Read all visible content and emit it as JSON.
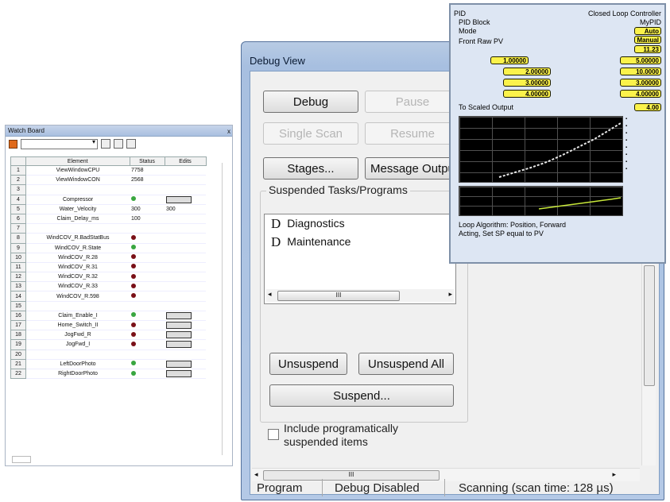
{
  "watch": {
    "title": "Watch Board",
    "close_glyph": "x",
    "headers": {
      "element": "Element",
      "status": "Status",
      "edit": "Edits"
    },
    "rows": [
      {
        "n": "1",
        "element": "ViewWindowCPU",
        "status": "7758",
        "edit": "",
        "kind": "text"
      },
      {
        "n": "2",
        "element": "ViewWindowCON",
        "status": "2568",
        "edit": "",
        "kind": "text"
      },
      {
        "n": "3",
        "element": "",
        "status": "",
        "edit": "",
        "kind": "blank"
      },
      {
        "n": "4",
        "element": "Compressor",
        "status": "",
        "edit": "",
        "kind": "green-mini"
      },
      {
        "n": "5",
        "element": "Water_Velocity",
        "status": "300",
        "edit": "300",
        "kind": "text"
      },
      {
        "n": "6",
        "element": "Claim_Delay_ms",
        "status": "100",
        "edit": "",
        "kind": "text"
      },
      {
        "n": "7",
        "element": "",
        "status": "",
        "edit": "",
        "kind": "blank"
      },
      {
        "n": "8",
        "element": "WindCOV_R.BadStatBus",
        "status": "",
        "edit": "",
        "kind": "red"
      },
      {
        "n": "9",
        "element": "WindCOV_R.State",
        "status": "",
        "edit": "",
        "kind": "green"
      },
      {
        "n": "10",
        "element": "WindCOV_R.28",
        "status": "",
        "edit": "",
        "kind": "red"
      },
      {
        "n": "11",
        "element": "WindCOV_R.31",
        "status": "",
        "edit": "",
        "kind": "red"
      },
      {
        "n": "12",
        "element": "WindCOV_R.32",
        "status": "",
        "edit": "",
        "kind": "red"
      },
      {
        "n": "13",
        "element": "WindCOV_R.33",
        "status": "",
        "edit": "",
        "kind": "red"
      },
      {
        "n": "14",
        "element": "WindCOV_R.598",
        "status": "",
        "edit": "",
        "kind": "red"
      },
      {
        "n": "15",
        "element": "",
        "status": "",
        "edit": "",
        "kind": "blank"
      },
      {
        "n": "16",
        "element": "Claim_Enable_I",
        "status": "",
        "edit": "",
        "kind": "green-mini"
      },
      {
        "n": "17",
        "element": "Home_Switch_II",
        "status": "",
        "edit": "",
        "kind": "red-mini"
      },
      {
        "n": "18",
        "element": "JogFwd_R",
        "status": "",
        "edit": "",
        "kind": "red-mini"
      },
      {
        "n": "19",
        "element": "JogFwd_I",
        "status": "",
        "edit": "",
        "kind": "red-mini"
      },
      {
        "n": "20",
        "element": "",
        "status": "",
        "edit": "",
        "kind": "blank"
      },
      {
        "n": "21",
        "element": "LeftDoorPhoto",
        "status": "",
        "edit": "",
        "kind": "green-mini"
      },
      {
        "n": "22",
        "element": "RightDoorPhoto",
        "status": "",
        "edit": "",
        "kind": "green-mini"
      }
    ]
  },
  "debug": {
    "title": "Debug View",
    "close_glyph": "x",
    "buttons": {
      "debug": "Debug",
      "pause": "Pause",
      "single_scan": "Single Scan",
      "resume": "Resume",
      "stages": "Stages...",
      "message_output": "Message Output"
    },
    "group_label": "Suspended Tasks/Programs",
    "suspended_items": [
      "Diagnostics",
      "Maintenance"
    ],
    "list_item_glyph": "D",
    "scroll_grip": "III",
    "scroll_left": "◂",
    "scroll_right": "▸",
    "unsuspend": "Unsuspend",
    "unsuspend_all": "Unsuspend All",
    "suspend": "Suspend...",
    "include_label": "Include programatically suspended items",
    "status": {
      "program": "Program",
      "debug_state": "Debug Disabled",
      "scanning": "Scanning (scan time: 128 µs)"
    }
  },
  "pid": {
    "title_left": "PID",
    "title_right": "Closed Loop Controller",
    "pid_block_label": "PID Block",
    "pid_block_value": "MyPID",
    "mode_label": "Mode",
    "mode_values": [
      "Auto",
      "Manual"
    ],
    "front_label": "Front Raw PV",
    "front_value": "11.23",
    "left_values": [
      "1.00000",
      "2.00000",
      "3.00000",
      "4.00000"
    ],
    "right_values": [
      "5.00000",
      "10.0000",
      "3.00000",
      "4.00000",
      "4.00"
    ],
    "scaled_output_label": "To Scaled Output",
    "footer_line1": "Loop Algorithm: Position, Forward",
    "footer_line2": "Acting, Set SP equal to PV",
    "colors": {
      "chip": "#fbf24b",
      "trend_bg": "#000000",
      "trend_line": "#e8e8e8",
      "output_line": "#c8e83a"
    }
  }
}
